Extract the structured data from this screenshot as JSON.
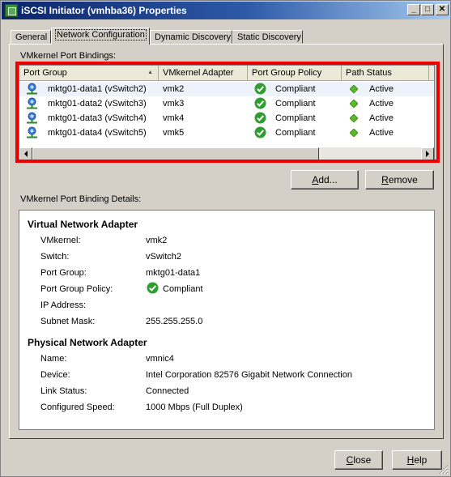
{
  "window": {
    "title": "iSCSI Initiator (vmhba36) Properties",
    "minimize_glyph": "_",
    "maximize_glyph": "□",
    "close_glyph": "✕"
  },
  "tabs": [
    {
      "label": "General",
      "active": false
    },
    {
      "label": "Network Configuration",
      "active": true
    },
    {
      "label": "Dynamic Discovery",
      "active": false
    },
    {
      "label": "Static Discovery",
      "active": false
    }
  ],
  "bindings": {
    "section_label": "VMkernel Port Bindings:",
    "columns": [
      "Port Group",
      "VMkernel Adapter",
      "Port Group Policy",
      "Path Status"
    ],
    "rows": [
      {
        "port_group": "mktg01-data1 (vSwitch2)",
        "adapter": "vmk2",
        "policy": "Compliant",
        "path_status": "Active"
      },
      {
        "port_group": "mktg01-data2 (vSwitch3)",
        "adapter": "vmk3",
        "policy": "Compliant",
        "path_status": "Active"
      },
      {
        "port_group": "mktg01-data3 (vSwitch4)",
        "adapter": "vmk4",
        "policy": "Compliant",
        "path_status": "Active"
      },
      {
        "port_group": "mktg01-data4 (vSwitch5)",
        "adapter": "vmk5",
        "policy": "Compliant",
        "path_status": "Active"
      }
    ]
  },
  "buttons": {
    "add_pre": "",
    "add_ul": "A",
    "add_post": "dd...",
    "remove_pre": "",
    "remove_ul": "R",
    "remove_post": "emove",
    "close_pre": "",
    "close_ul": "C",
    "close_post": "lose",
    "help_pre": "",
    "help_ul": "H",
    "help_post": "elp"
  },
  "details": {
    "section_label": "VMkernel Port Binding Details:",
    "virtual_heading": "Virtual Network Adapter",
    "virtual": [
      {
        "key": "VMkernel:",
        "value": "vmk2"
      },
      {
        "key": "Switch:",
        "value": "vSwitch2"
      },
      {
        "key": "Port Group:",
        "value": "mktg01-data1"
      },
      {
        "key": "Port Group Policy:",
        "value": "Compliant"
      },
      {
        "key": "IP Address:",
        "value": ""
      },
      {
        "key": "Subnet Mask:",
        "value": "255.255.255.0"
      }
    ],
    "physical_heading": "Physical Network Adapter",
    "physical": [
      {
        "key": "Name:",
        "value": "vmnic4"
      },
      {
        "key": "Device:",
        "value": "Intel Corporation 82576 Gigabit Network Connection"
      },
      {
        "key": "Link Status:",
        "value": "Connected"
      },
      {
        "key": "Configured Speed:",
        "value": "1000 Mbps (Full Duplex)"
      }
    ]
  },
  "colors": {
    "highlight_frame": "#ee0000",
    "compliant_green": "#2e9e2e",
    "active_green": "#5cb82a"
  }
}
